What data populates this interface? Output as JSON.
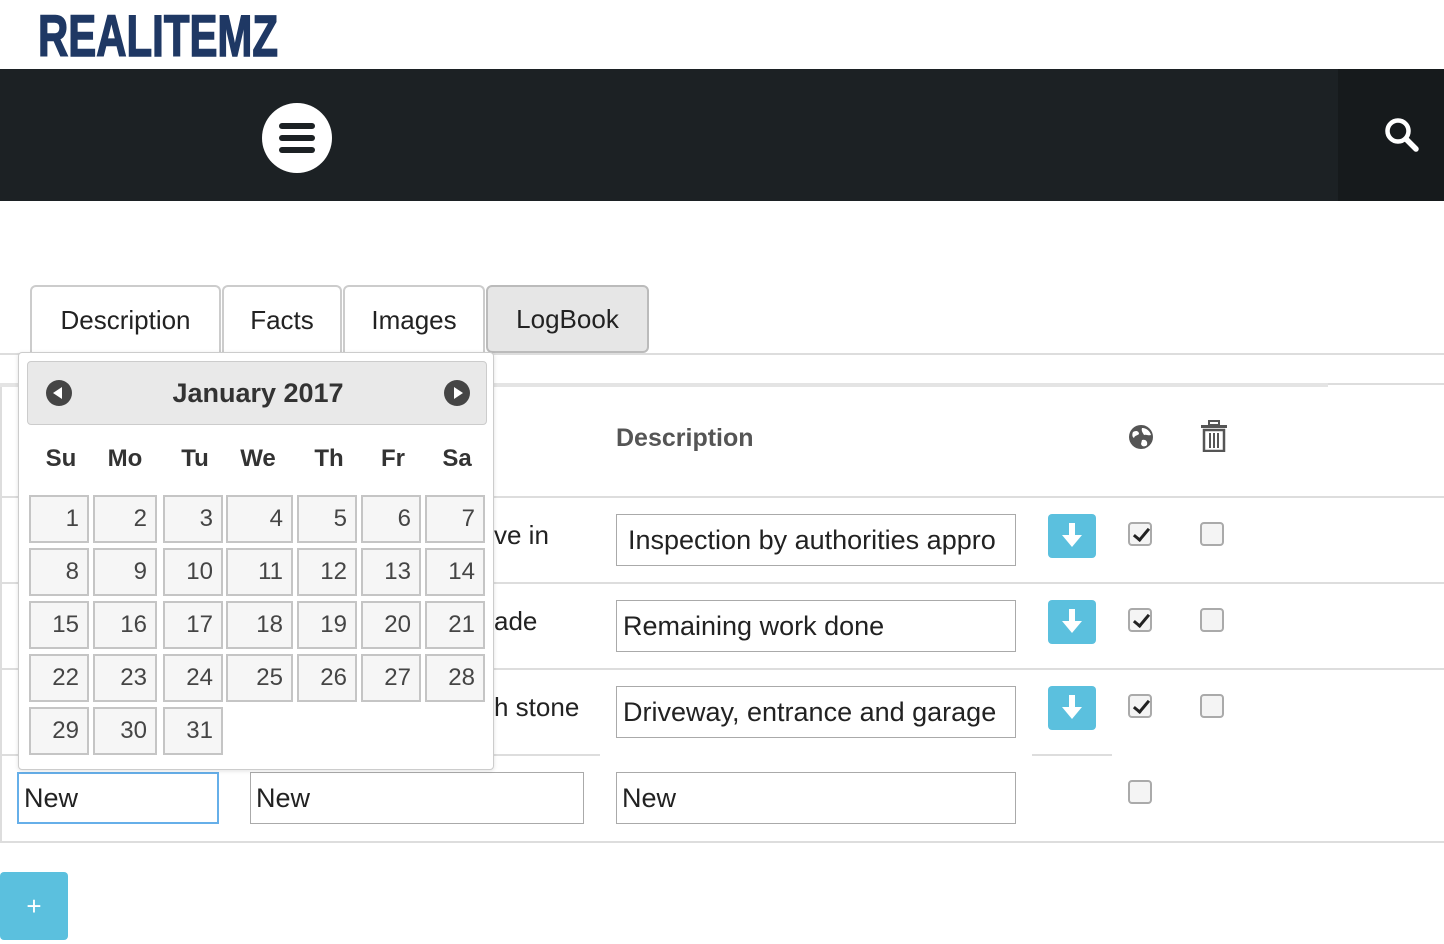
{
  "brand": {
    "logo_text": "REALITEMZ"
  },
  "navbar": {
    "menu_icon": "hamburger-menu-icon",
    "search_icon": "search-icon"
  },
  "tabs": [
    {
      "label": "Description"
    },
    {
      "label": "Facts"
    },
    {
      "label": "Images"
    },
    {
      "label": "LogBook",
      "active": true
    }
  ],
  "logbook": {
    "columns": {
      "description": "Description",
      "globe_icon": "globe-icon",
      "trash_icon": "trash-icon"
    },
    "rows": [
      {
        "title_visible": "ve in",
        "description": "Inspection by authorities appro",
        "published": true,
        "delete": false
      },
      {
        "title_visible": "ade",
        "description": "Remaining work done",
        "published": true,
        "delete": false
      },
      {
        "title_visible": "h stone",
        "description": "Driveway, entrance and garage",
        "published": true,
        "delete": false
      }
    ],
    "new_row": {
      "date": "New",
      "title": "New",
      "description": "New",
      "published": false
    },
    "add_label": "+"
  },
  "datepicker": {
    "title": "January 2017",
    "weekdays": [
      "Su",
      "Mo",
      "Tu",
      "We",
      "Th",
      "Fr",
      "Sa"
    ],
    "days": [
      "1",
      "2",
      "3",
      "4",
      "5",
      "6",
      "7",
      "8",
      "9",
      "10",
      "11",
      "12",
      "13",
      "14",
      "15",
      "16",
      "17",
      "18",
      "19",
      "20",
      "21",
      "22",
      "23",
      "24",
      "25",
      "26",
      "27",
      "28",
      "29",
      "30",
      "31"
    ]
  },
  "colors": {
    "navbar": "#1c2124",
    "accent": "#5bc0de",
    "logo": "#1f3864"
  }
}
